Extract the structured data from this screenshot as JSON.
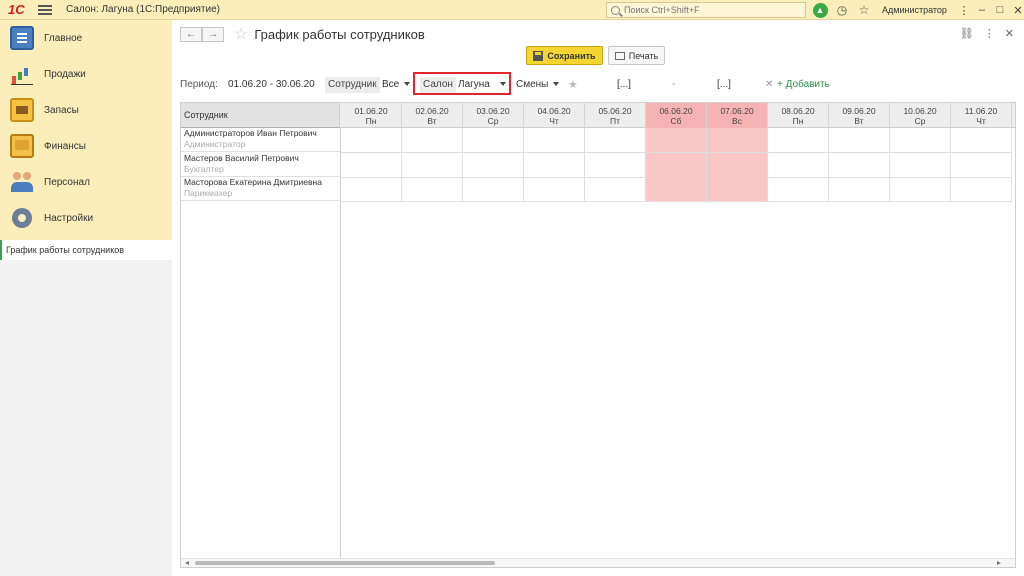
{
  "app": {
    "logo": "1С",
    "title": "Салон: Лагуна  (1С:Предприятие)",
    "search_placeholder": "Поиск Ctrl+Shift+F",
    "user": "Администратор"
  },
  "sidebar": {
    "items": [
      {
        "label": "Главное",
        "icon": "main-icon"
      },
      {
        "label": "Продажи",
        "icon": "sales-chart-icon"
      },
      {
        "label": "Запасы",
        "icon": "stock-icon"
      },
      {
        "label": "Финансы",
        "icon": "wallet-icon"
      },
      {
        "label": "Персонал",
        "icon": "staff-icon"
      },
      {
        "label": "Настройки",
        "icon": "gear-icon"
      }
    ],
    "opened": "График работы сотрудников"
  },
  "page": {
    "title": "График работы сотрудников",
    "save_label": "Сохранить",
    "print_label": "Печать"
  },
  "filters": {
    "period_label": "Период:",
    "period_value": "01.06.20 - 30.06.20",
    "employee_label": "Сотрудник",
    "employee_value": "Все",
    "salon_label": "Салон",
    "salon_value": "Лагуна",
    "shifts_label": "Смены",
    "range_from": "[...]",
    "range_dash": "-",
    "range_to": "[...]",
    "add_label": "+ Добавить"
  },
  "table": {
    "name_header": "Сотрудник",
    "days": [
      {
        "date": "01.06.20",
        "dow": "Пн",
        "weekend": false
      },
      {
        "date": "02.06.20",
        "dow": "Вт",
        "weekend": false
      },
      {
        "date": "03.06.20",
        "dow": "Ср",
        "weekend": false
      },
      {
        "date": "04.06.20",
        "dow": "Чт",
        "weekend": false
      },
      {
        "date": "05.06.20",
        "dow": "Пт",
        "weekend": false
      },
      {
        "date": "06.06.20",
        "dow": "Сб",
        "weekend": true
      },
      {
        "date": "07.06.20",
        "dow": "Вс",
        "weekend": true
      },
      {
        "date": "08.06.20",
        "dow": "Пн",
        "weekend": false
      },
      {
        "date": "09.06.20",
        "dow": "Вт",
        "weekend": false
      },
      {
        "date": "10.06.20",
        "dow": "Ср",
        "weekend": false
      },
      {
        "date": "11.06.20",
        "dow": "Чт",
        "weekend": false
      }
    ],
    "employees": [
      {
        "name": "Администраторов Иван Петрович",
        "role": "Администратор"
      },
      {
        "name": "Мастеров Василий Петрович",
        "role": "Бухгалтер"
      },
      {
        "name": "Масторова Екатерина Дмитриевна",
        "role": "Парикмахер"
      }
    ]
  },
  "colors": {
    "accent_yellow": "#f4d531",
    "weekend": "#f9c7c7",
    "highlight_box": "#e1262b",
    "add_link": "#2e8f4a"
  }
}
